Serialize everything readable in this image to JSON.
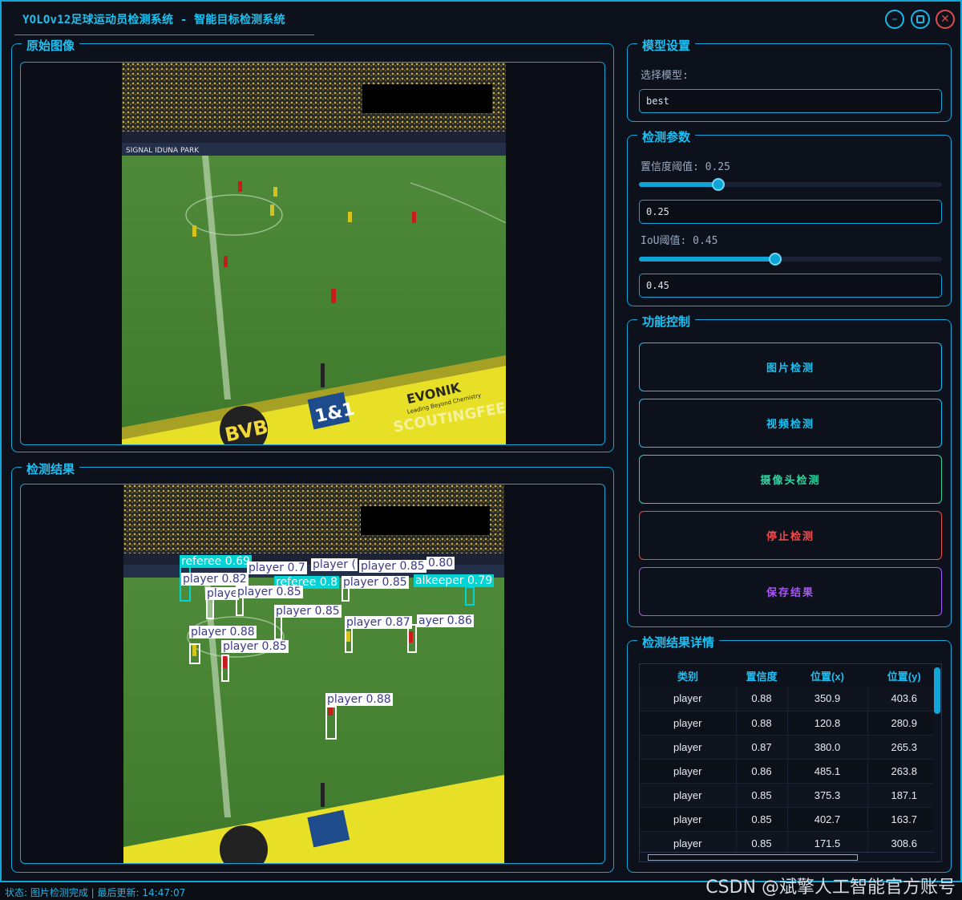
{
  "window": {
    "title": "YOLOv12足球运动员检测系统 - 智能目标检测系统",
    "minimize_icon": "minimize-icon",
    "maximize_icon": "maximize-icon",
    "close_icon": "close-icon"
  },
  "panels": {
    "original": {
      "title": "原始图像"
    },
    "result": {
      "title": "检测结果"
    }
  },
  "model_settings": {
    "title": "模型设置",
    "select_label": "选择模型:",
    "selected_model": "best"
  },
  "detect_params": {
    "title": "检测参数",
    "conf_label": "置信度阈值: 0.25",
    "conf_value": 0.25,
    "conf_text": "0.25",
    "iou_label": "IoU阈值: 0.45",
    "iou_value": 0.45,
    "iou_text": "0.45"
  },
  "controls": {
    "title": "功能控制",
    "buttons": [
      {
        "label": "图片检测",
        "color": "#1cc0f2"
      },
      {
        "label": "视频检测",
        "color": "#1cc0f2"
      },
      {
        "label": "摄像头检测",
        "color": "#2ed3a0"
      },
      {
        "label": "停止检测",
        "color": "#ef4d4d"
      },
      {
        "label": "保存结果",
        "color": "#a855f7"
      }
    ]
  },
  "details": {
    "title": "检测结果详情",
    "columns": [
      "类别",
      "置信度",
      "位置(x)",
      "位置(y)"
    ],
    "rows": [
      [
        "player",
        "0.88",
        "350.9",
        "403.6"
      ],
      [
        "player",
        "0.88",
        "120.8",
        "280.9"
      ],
      [
        "player",
        "0.87",
        "380.0",
        "265.3"
      ],
      [
        "player",
        "0.86",
        "485.1",
        "263.8"
      ],
      [
        "player",
        "0.85",
        "375.3",
        "187.1"
      ],
      [
        "player",
        "0.85",
        "402.7",
        "163.7"
      ],
      [
        "player",
        "0.85",
        "171.5",
        "308.6"
      ]
    ]
  },
  "detections": [
    {
      "label": "referee 0.69",
      "color": "#00d4d4"
    },
    {
      "label": "player 0.7",
      "color": "#ffffff"
    },
    {
      "label": "player (",
      "color": "#ffffff"
    },
    {
      "label": "player 0.85",
      "color": "#ffffff"
    },
    {
      "label": "0.80",
      "color": "#ffffff"
    },
    {
      "label": "player 0.82",
      "color": "#ffffff"
    },
    {
      "label": "referee 0.8",
      "color": "#00d4d4"
    },
    {
      "label": "player 0.85",
      "color": "#ffffff"
    },
    {
      "label": "alkeeper 0.79",
      "color": "#00d4d4"
    },
    {
      "label": "playe",
      "color": "#ffffff"
    },
    {
      "label": "player 0.85",
      "color": "#ffffff"
    },
    {
      "label": "player 0.85",
      "color": "#ffffff"
    },
    {
      "label": "player 0.87",
      "color": "#ffffff"
    },
    {
      "label": "ayer 0.86",
      "color": "#ffffff"
    },
    {
      "label": "player 0.88",
      "color": "#ffffff"
    },
    {
      "label": "player 0.85",
      "color": "#ffffff"
    },
    {
      "label": "player 0.88",
      "color": "#ffffff"
    }
  ],
  "photo_text": {
    "signal_iduna_park": "SIGNAL IDUNA PARK",
    "evonik": "EVONIK",
    "evonik_sub": "Leading Beyond Chemistry",
    "one_and_one": "1&1",
    "bvb": "BVB",
    "scoutingfeed": "SCOUTINGFEED"
  },
  "status": {
    "text": "状态: 图片检测完成 | 最后更新: 14:47:07"
  },
  "watermark": "CSDN @斌擎人工智能官方账号"
}
